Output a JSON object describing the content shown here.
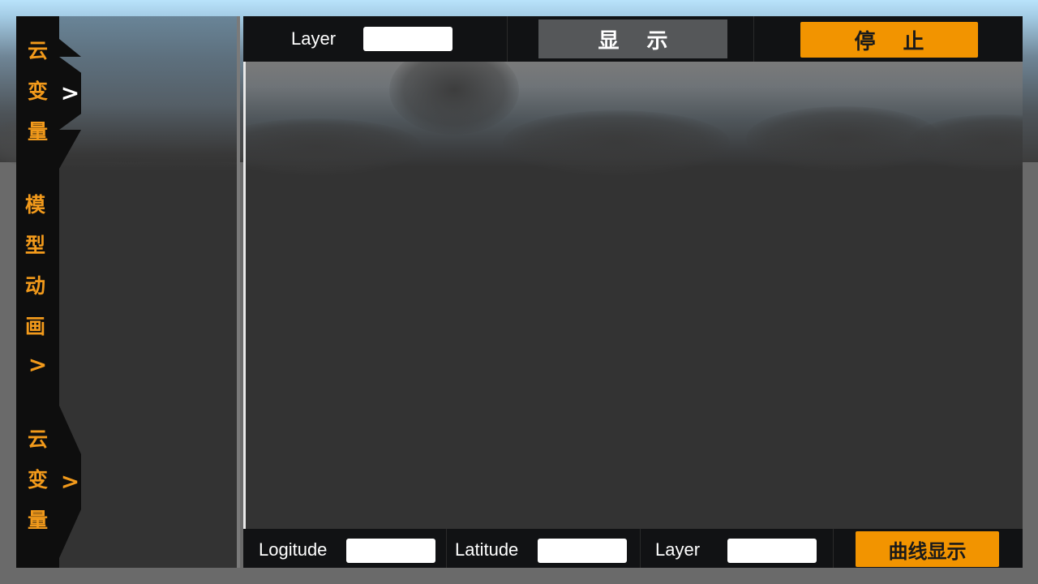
{
  "sidebar": {
    "group1": {
      "chars": [
        "云",
        "变",
        "量"
      ],
      "tab_chevron": ">"
    },
    "group2": {
      "chars": [
        "模",
        "型",
        "动",
        "画"
      ],
      "chevron": ">"
    },
    "group3": {
      "chars": [
        "云",
        "变",
        "量"
      ],
      "tab_chevron": ">"
    }
  },
  "top_toolbar": {
    "layer_label": "Layer",
    "layer_value": "",
    "show_button": "显示",
    "stop_button": "停止"
  },
  "bottom_toolbar": {
    "longitude_label": "Logitude",
    "longitude_value": "",
    "latitude_label": "Latitude",
    "latitude_value": "",
    "layer_label": "Layer",
    "layer_value": "",
    "curve_button": "曲线显示"
  },
  "colors": {
    "accent": "#f29400",
    "toolbar_bg": "#111214",
    "viewport_bg": "#333333"
  },
  "icons": {
    "tab_icon": "chevron-right-icon"
  }
}
